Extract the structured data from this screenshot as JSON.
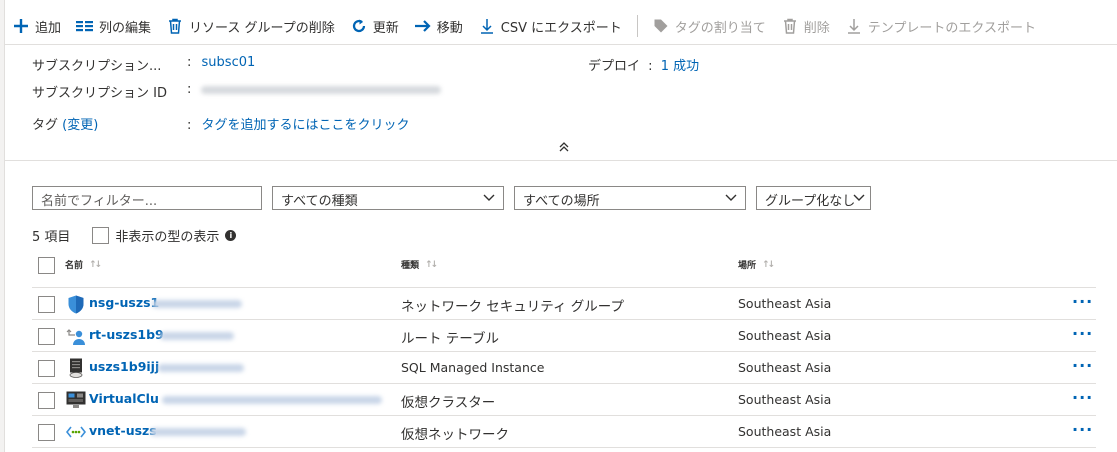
{
  "toolbar": {
    "add": "追加",
    "edit_columns": "列の編集",
    "delete_group": "リソース グループの削除",
    "refresh": "更新",
    "move": "移動",
    "export_csv": "CSV にエクスポート",
    "assign_tags": "タグの割り当て",
    "delete": "削除",
    "export_template": "テンプレートのエクスポート"
  },
  "essentials": {
    "subscription_label": "サブスクリプション...",
    "subscription_value": "subsc01",
    "subscription_id_label": "サブスクリプション ID",
    "tags_label": "タグ",
    "tags_change": "(変更)",
    "tags_value": "タグを追加するにはここをクリック",
    "deploy_label": "デプロイ",
    "deploy_value": "1 成功",
    "colon": ":"
  },
  "filters": {
    "name_placeholder": "名前でフィルター...",
    "type_select": "すべての種類",
    "location_select": "すべての場所",
    "group_select": "グループ化なし"
  },
  "list": {
    "count": "5 項目",
    "show_hidden": "非表示の型の表示",
    "columns": {
      "name": "名前",
      "type": "種類",
      "location": "場所"
    },
    "rows": [
      {
        "name": "nsg-uszs1",
        "type": "ネットワーク セキュリティ グループ",
        "location": "Southeast Asia",
        "icon": "shield-icon"
      },
      {
        "name": "rt-uszs1b9",
        "type": "ルート テーブル",
        "location": "Southeast Asia",
        "icon": "route-table-icon"
      },
      {
        "name": "uszs1b9ijj",
        "type": "SQL Managed Instance",
        "location": "Southeast Asia",
        "icon": "sql-managed-instance-icon"
      },
      {
        "name": "VirtualClu",
        "type": "仮想クラスター",
        "location": "Southeast Asia",
        "icon": "virtual-cluster-icon"
      },
      {
        "name": "vnet-uszs",
        "type": "仮想ネットワーク",
        "location": "Southeast Asia",
        "icon": "virtual-network-icon"
      }
    ]
  },
  "colors": {
    "accent": "#0064b4",
    "text": "#323130",
    "disabled": "#a19f9d",
    "border": "#e1dfdd"
  }
}
